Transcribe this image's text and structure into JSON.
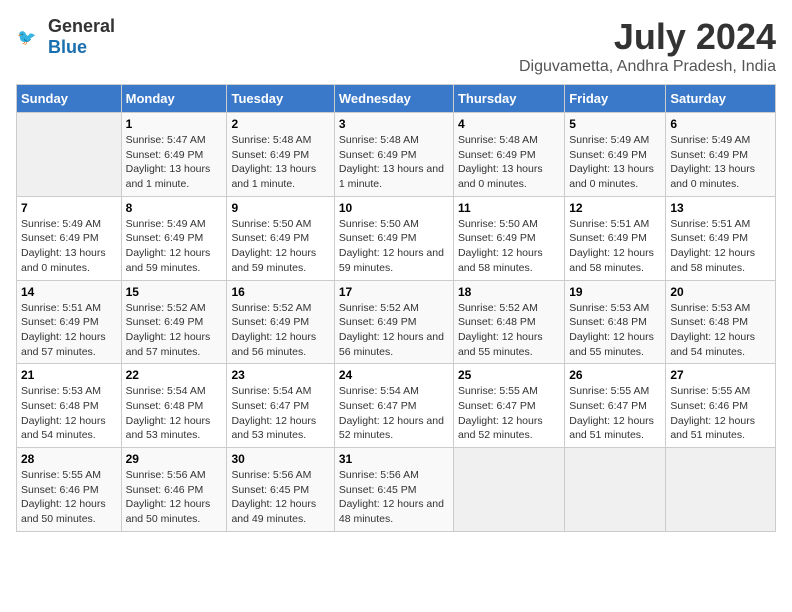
{
  "header": {
    "logo_general": "General",
    "logo_blue": "Blue",
    "title": "July 2024",
    "subtitle": "Diguvametta, Andhra Pradesh, India"
  },
  "calendar": {
    "days_of_week": [
      "Sunday",
      "Monday",
      "Tuesday",
      "Wednesday",
      "Thursday",
      "Friday",
      "Saturday"
    ],
    "weeks": [
      [
        {
          "day": "",
          "info": ""
        },
        {
          "day": "1",
          "info": "Sunrise: 5:47 AM\nSunset: 6:49 PM\nDaylight: 13 hours and 1 minute."
        },
        {
          "day": "2",
          "info": "Sunrise: 5:48 AM\nSunset: 6:49 PM\nDaylight: 13 hours and 1 minute."
        },
        {
          "day": "3",
          "info": "Sunrise: 5:48 AM\nSunset: 6:49 PM\nDaylight: 13 hours and 1 minute."
        },
        {
          "day": "4",
          "info": "Sunrise: 5:48 AM\nSunset: 6:49 PM\nDaylight: 13 hours and 0 minutes."
        },
        {
          "day": "5",
          "info": "Sunrise: 5:49 AM\nSunset: 6:49 PM\nDaylight: 13 hours and 0 minutes."
        },
        {
          "day": "6",
          "info": "Sunrise: 5:49 AM\nSunset: 6:49 PM\nDaylight: 13 hours and 0 minutes."
        }
      ],
      [
        {
          "day": "7",
          "info": "Sunrise: 5:49 AM\nSunset: 6:49 PM\nDaylight: 13 hours and 0 minutes."
        },
        {
          "day": "8",
          "info": "Sunrise: 5:49 AM\nSunset: 6:49 PM\nDaylight: 12 hours and 59 minutes."
        },
        {
          "day": "9",
          "info": "Sunrise: 5:50 AM\nSunset: 6:49 PM\nDaylight: 12 hours and 59 minutes."
        },
        {
          "day": "10",
          "info": "Sunrise: 5:50 AM\nSunset: 6:49 PM\nDaylight: 12 hours and 59 minutes."
        },
        {
          "day": "11",
          "info": "Sunrise: 5:50 AM\nSunset: 6:49 PM\nDaylight: 12 hours and 58 minutes."
        },
        {
          "day": "12",
          "info": "Sunrise: 5:51 AM\nSunset: 6:49 PM\nDaylight: 12 hours and 58 minutes."
        },
        {
          "day": "13",
          "info": "Sunrise: 5:51 AM\nSunset: 6:49 PM\nDaylight: 12 hours and 58 minutes."
        }
      ],
      [
        {
          "day": "14",
          "info": "Sunrise: 5:51 AM\nSunset: 6:49 PM\nDaylight: 12 hours and 57 minutes."
        },
        {
          "day": "15",
          "info": "Sunrise: 5:52 AM\nSunset: 6:49 PM\nDaylight: 12 hours and 57 minutes."
        },
        {
          "day": "16",
          "info": "Sunrise: 5:52 AM\nSunset: 6:49 PM\nDaylight: 12 hours and 56 minutes."
        },
        {
          "day": "17",
          "info": "Sunrise: 5:52 AM\nSunset: 6:49 PM\nDaylight: 12 hours and 56 minutes."
        },
        {
          "day": "18",
          "info": "Sunrise: 5:52 AM\nSunset: 6:48 PM\nDaylight: 12 hours and 55 minutes."
        },
        {
          "day": "19",
          "info": "Sunrise: 5:53 AM\nSunset: 6:48 PM\nDaylight: 12 hours and 55 minutes."
        },
        {
          "day": "20",
          "info": "Sunrise: 5:53 AM\nSunset: 6:48 PM\nDaylight: 12 hours and 54 minutes."
        }
      ],
      [
        {
          "day": "21",
          "info": "Sunrise: 5:53 AM\nSunset: 6:48 PM\nDaylight: 12 hours and 54 minutes."
        },
        {
          "day": "22",
          "info": "Sunrise: 5:54 AM\nSunset: 6:48 PM\nDaylight: 12 hours and 53 minutes."
        },
        {
          "day": "23",
          "info": "Sunrise: 5:54 AM\nSunset: 6:47 PM\nDaylight: 12 hours and 53 minutes."
        },
        {
          "day": "24",
          "info": "Sunrise: 5:54 AM\nSunset: 6:47 PM\nDaylight: 12 hours and 52 minutes."
        },
        {
          "day": "25",
          "info": "Sunrise: 5:55 AM\nSunset: 6:47 PM\nDaylight: 12 hours and 52 minutes."
        },
        {
          "day": "26",
          "info": "Sunrise: 5:55 AM\nSunset: 6:47 PM\nDaylight: 12 hours and 51 minutes."
        },
        {
          "day": "27",
          "info": "Sunrise: 5:55 AM\nSunset: 6:46 PM\nDaylight: 12 hours and 51 minutes."
        }
      ],
      [
        {
          "day": "28",
          "info": "Sunrise: 5:55 AM\nSunset: 6:46 PM\nDaylight: 12 hours and 50 minutes."
        },
        {
          "day": "29",
          "info": "Sunrise: 5:56 AM\nSunset: 6:46 PM\nDaylight: 12 hours and 50 minutes."
        },
        {
          "day": "30",
          "info": "Sunrise: 5:56 AM\nSunset: 6:45 PM\nDaylight: 12 hours and 49 minutes."
        },
        {
          "day": "31",
          "info": "Sunrise: 5:56 AM\nSunset: 6:45 PM\nDaylight: 12 hours and 48 minutes."
        },
        {
          "day": "",
          "info": ""
        },
        {
          "day": "",
          "info": ""
        },
        {
          "day": "",
          "info": ""
        }
      ]
    ]
  }
}
